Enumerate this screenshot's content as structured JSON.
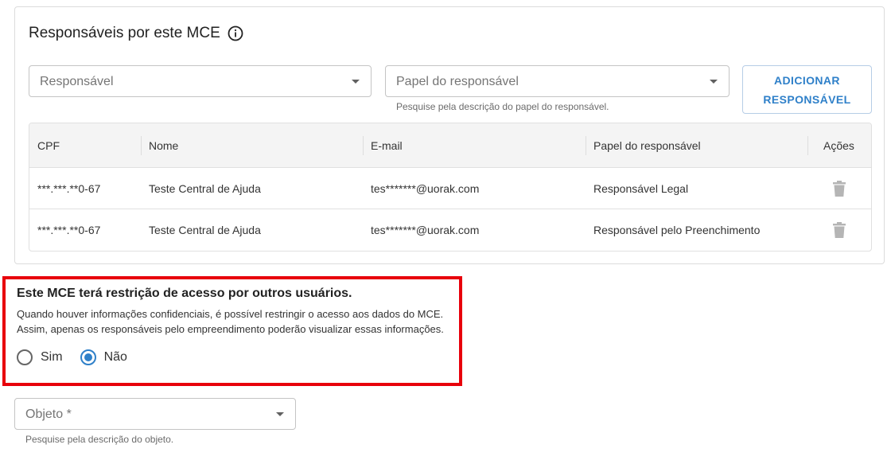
{
  "responsaveis": {
    "title": "Responsáveis por este MCE",
    "responsavel_select": {
      "placeholder": "Responsável"
    },
    "papel_select": {
      "placeholder": "Papel do responsável",
      "helper": "Pesquise pela descrição do papel do responsável."
    },
    "add_button": {
      "line1": "ADICIONAR",
      "line2": "RESPONSÁVEL"
    },
    "table": {
      "columns": [
        "CPF",
        "Nome",
        "E-mail",
        "Papel do responsável",
        "Ações"
      ],
      "rows": [
        {
          "cpf": "***.***.**0-67",
          "nome": "Teste Central de Ajuda",
          "email": "tes*******@uorak.com",
          "papel": "Responsável Legal"
        },
        {
          "cpf": "***.***.**0-67",
          "nome": "Teste Central de Ajuda",
          "email": "tes*******@uorak.com",
          "papel": "Responsável pelo Preenchimento"
        }
      ]
    }
  },
  "restricao": {
    "title": "Este MCE terá restrição de acesso por outros usuários.",
    "desc_line1": "Quando houver informações confidenciais, é possível restringir o acesso aos dados do MCE.",
    "desc_line2": "Assim, apenas os responsáveis pelo empreendimento poderão visualizar essas informações.",
    "options": [
      {
        "label": "Sim",
        "checked": false
      },
      {
        "label": "Não",
        "checked": true
      }
    ]
  },
  "objeto": {
    "placeholder": "Objeto *",
    "helper": "Pesquise pela descrição do objeto."
  },
  "colors": {
    "accent": "#2f80c9",
    "highlight_border": "#e8000b"
  }
}
